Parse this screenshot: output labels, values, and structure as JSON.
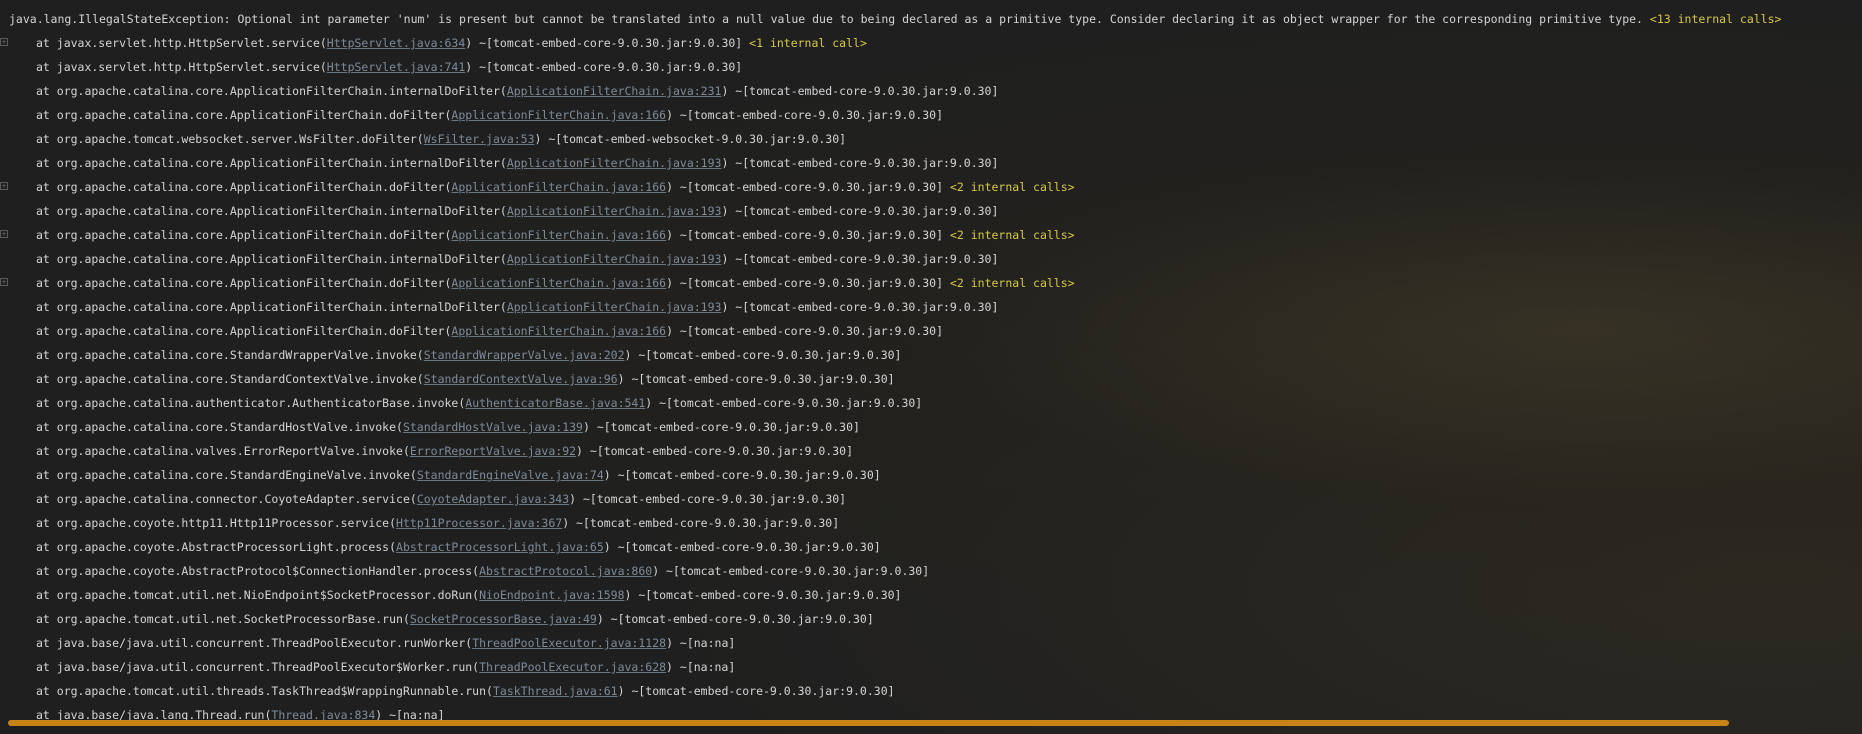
{
  "exception": {
    "message": "java.lang.IllegalStateException: Optional int parameter 'num' is present but cannot be translated into a null value due to being declared as a primitive type. Consider declaring it as object wrapper for the corresponding primitive type.",
    "internal_calls": "<13 internal calls>"
  },
  "frames": [
    {
      "method": "at javax.servlet.http.HttpServlet.service(",
      "source": "HttpServlet.java:634",
      "jar": ") ~[tomcat-embed-core-9.0.30.jar:9.0.30]",
      "internal": "<1 internal call>",
      "foldable": true
    },
    {
      "method": "at javax.servlet.http.HttpServlet.service(",
      "source": "HttpServlet.java:741",
      "jar": ") ~[tomcat-embed-core-9.0.30.jar:9.0.30]",
      "internal": "",
      "foldable": false
    },
    {
      "method": "at org.apache.catalina.core.ApplicationFilterChain.internalDoFilter(",
      "source": "ApplicationFilterChain.java:231",
      "jar": ") ~[tomcat-embed-core-9.0.30.jar:9.0.30]",
      "internal": "",
      "foldable": false
    },
    {
      "method": "at org.apache.catalina.core.ApplicationFilterChain.doFilter(",
      "source": "ApplicationFilterChain.java:166",
      "jar": ") ~[tomcat-embed-core-9.0.30.jar:9.0.30]",
      "internal": "",
      "foldable": false
    },
    {
      "method": "at org.apache.tomcat.websocket.server.WsFilter.doFilter(",
      "source": "WsFilter.java:53",
      "jar": ") ~[tomcat-embed-websocket-9.0.30.jar:9.0.30]",
      "internal": "",
      "foldable": false
    },
    {
      "method": "at org.apache.catalina.core.ApplicationFilterChain.internalDoFilter(",
      "source": "ApplicationFilterChain.java:193",
      "jar": ") ~[tomcat-embed-core-9.0.30.jar:9.0.30]",
      "internal": "",
      "foldable": false
    },
    {
      "method": "at org.apache.catalina.core.ApplicationFilterChain.doFilter(",
      "source": "ApplicationFilterChain.java:166",
      "jar": ") ~[tomcat-embed-core-9.0.30.jar:9.0.30]",
      "internal": "<2 internal calls>",
      "foldable": true
    },
    {
      "method": "at org.apache.catalina.core.ApplicationFilterChain.internalDoFilter(",
      "source": "ApplicationFilterChain.java:193",
      "jar": ") ~[tomcat-embed-core-9.0.30.jar:9.0.30]",
      "internal": "",
      "foldable": false
    },
    {
      "method": "at org.apache.catalina.core.ApplicationFilterChain.doFilter(",
      "source": "ApplicationFilterChain.java:166",
      "jar": ") ~[tomcat-embed-core-9.0.30.jar:9.0.30]",
      "internal": "<2 internal calls>",
      "foldable": true
    },
    {
      "method": "at org.apache.catalina.core.ApplicationFilterChain.internalDoFilter(",
      "source": "ApplicationFilterChain.java:193",
      "jar": ") ~[tomcat-embed-core-9.0.30.jar:9.0.30]",
      "internal": "",
      "foldable": false
    },
    {
      "method": "at org.apache.catalina.core.ApplicationFilterChain.doFilter(",
      "source": "ApplicationFilterChain.java:166",
      "jar": ") ~[tomcat-embed-core-9.0.30.jar:9.0.30]",
      "internal": "<2 internal calls>",
      "foldable": true
    },
    {
      "method": "at org.apache.catalina.core.ApplicationFilterChain.internalDoFilter(",
      "source": "ApplicationFilterChain.java:193",
      "jar": ") ~[tomcat-embed-core-9.0.30.jar:9.0.30]",
      "internal": "",
      "foldable": false
    },
    {
      "method": "at org.apache.catalina.core.ApplicationFilterChain.doFilter(",
      "source": "ApplicationFilterChain.java:166",
      "jar": ") ~[tomcat-embed-core-9.0.30.jar:9.0.30]",
      "internal": "",
      "foldable": false
    },
    {
      "method": "at org.apache.catalina.core.StandardWrapperValve.invoke(",
      "source": "StandardWrapperValve.java:202",
      "jar": ") ~[tomcat-embed-core-9.0.30.jar:9.0.30]",
      "internal": "",
      "foldable": false
    },
    {
      "method": "at org.apache.catalina.core.StandardContextValve.invoke(",
      "source": "StandardContextValve.java:96",
      "jar": ") ~[tomcat-embed-core-9.0.30.jar:9.0.30]",
      "internal": "",
      "foldable": false
    },
    {
      "method": "at org.apache.catalina.authenticator.AuthenticatorBase.invoke(",
      "source": "AuthenticatorBase.java:541",
      "jar": ") ~[tomcat-embed-core-9.0.30.jar:9.0.30]",
      "internal": "",
      "foldable": false
    },
    {
      "method": "at org.apache.catalina.core.StandardHostValve.invoke(",
      "source": "StandardHostValve.java:139",
      "jar": ") ~[tomcat-embed-core-9.0.30.jar:9.0.30]",
      "internal": "",
      "foldable": false
    },
    {
      "method": "at org.apache.catalina.valves.ErrorReportValve.invoke(",
      "source": "ErrorReportValve.java:92",
      "jar": ") ~[tomcat-embed-core-9.0.30.jar:9.0.30]",
      "internal": "",
      "foldable": false
    },
    {
      "method": "at org.apache.catalina.core.StandardEngineValve.invoke(",
      "source": "StandardEngineValve.java:74",
      "jar": ") ~[tomcat-embed-core-9.0.30.jar:9.0.30]",
      "internal": "",
      "foldable": false
    },
    {
      "method": "at org.apache.catalina.connector.CoyoteAdapter.service(",
      "source": "CoyoteAdapter.java:343",
      "jar": ") ~[tomcat-embed-core-9.0.30.jar:9.0.30]",
      "internal": "",
      "foldable": false
    },
    {
      "method": "at org.apache.coyote.http11.Http11Processor.service(",
      "source": "Http11Processor.java:367",
      "jar": ") ~[tomcat-embed-core-9.0.30.jar:9.0.30]",
      "internal": "",
      "foldable": false
    },
    {
      "method": "at org.apache.coyote.AbstractProcessorLight.process(",
      "source": "AbstractProcessorLight.java:65",
      "jar": ") ~[tomcat-embed-core-9.0.30.jar:9.0.30]",
      "internal": "",
      "foldable": false
    },
    {
      "method": "at org.apache.coyote.AbstractProtocol$ConnectionHandler.process(",
      "source": "AbstractProtocol.java:860",
      "jar": ") ~[tomcat-embed-core-9.0.30.jar:9.0.30]",
      "internal": "",
      "foldable": false
    },
    {
      "method": "at org.apache.tomcat.util.net.NioEndpoint$SocketProcessor.doRun(",
      "source": "NioEndpoint.java:1598",
      "jar": ") ~[tomcat-embed-core-9.0.30.jar:9.0.30]",
      "internal": "",
      "foldable": false
    },
    {
      "method": "at org.apache.tomcat.util.net.SocketProcessorBase.run(",
      "source": "SocketProcessorBase.java:49",
      "jar": ") ~[tomcat-embed-core-9.0.30.jar:9.0.30]",
      "internal": "",
      "foldable": false
    },
    {
      "method": "at java.base/java.util.concurrent.ThreadPoolExecutor.runWorker(",
      "source": "ThreadPoolExecutor.java:1128",
      "jar": ") ~[na:na]",
      "internal": "",
      "foldable": false
    },
    {
      "method": "at java.base/java.util.concurrent.ThreadPoolExecutor$Worker.run(",
      "source": "ThreadPoolExecutor.java:628",
      "jar": ") ~[na:na]",
      "internal": "",
      "foldable": false
    },
    {
      "method": "at org.apache.tomcat.util.threads.TaskThread$WrappingRunnable.run(",
      "source": "TaskThread.java:61",
      "jar": ") ~[tomcat-embed-core-9.0.30.jar:9.0.30]",
      "internal": "",
      "foldable": false
    },
    {
      "method": "at java.base/java.lang.Thread.run(",
      "source": "Thread.java:834",
      "jar": ") ~[na:na]",
      "internal": "",
      "foldable": false
    }
  ],
  "icons": {
    "fold": "+"
  },
  "colors": {
    "background": "#1f1f1f",
    "text": "#d4d4d4",
    "link": "#7d8b99",
    "internal_calls": "#d6c84a",
    "scrollbar_thumb": "#c98417"
  },
  "scroll": {
    "horizontal_thumb_fraction": 0.93
  }
}
